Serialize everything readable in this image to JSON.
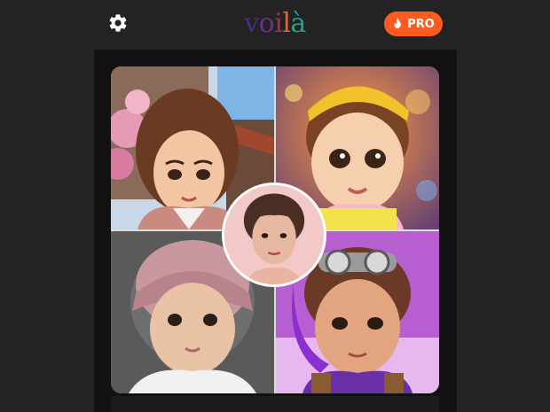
{
  "header": {
    "settings_icon": "gear-icon",
    "logo_letters": [
      {
        "char": "v",
        "color": "#4a2a8a"
      },
      {
        "char": "o",
        "color": "#6a2e8c"
      },
      {
        "char": "i",
        "color": "#b02a4a"
      },
      {
        "char": "l",
        "color": "#e0633a"
      },
      {
        "char": "à",
        "color": "#22a08c"
      }
    ],
    "pro_label": "PRO",
    "pro_icon": "flame-icon",
    "pro_color": "#ff5a1f"
  },
  "gallery": {
    "tiles": [
      {
        "style": "anime illustration",
        "icon": "portrait-image"
      },
      {
        "style": "3d cartoon",
        "icon": "portrait-image"
      },
      {
        "style": "child photo",
        "icon": "portrait-image"
      },
      {
        "style": "game character",
        "icon": "portrait-image"
      }
    ],
    "original": {
      "icon": "portrait-image"
    }
  }
}
